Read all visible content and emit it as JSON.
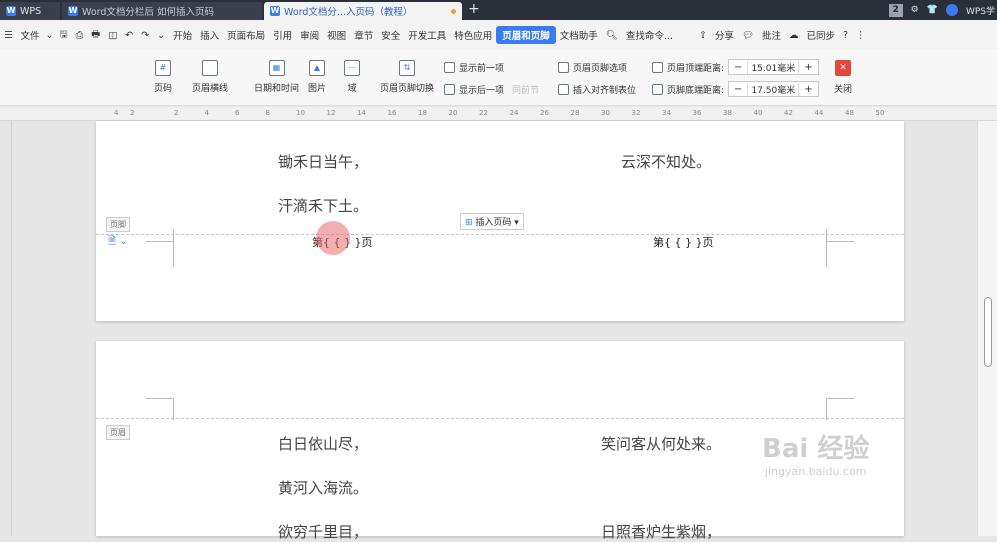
{
  "titlebar": {
    "wps": "WPS",
    "tab1": "Word文档分栏后 如何插入页码",
    "tab2": "Word文档分...入页码（教程）",
    "page_count": "2",
    "right_label": "WPS学"
  },
  "menu": {
    "items": [
      "文件",
      "开始",
      "插入",
      "页面布局",
      "引用",
      "审阅",
      "视图",
      "章节",
      "安全",
      "开发工具",
      "特色应用",
      "页眉和页脚",
      "文档助手"
    ],
    "search": "查找命令...",
    "share": "分享",
    "annotate": "批注",
    "sync": "已同步"
  },
  "ribbon": {
    "page_num": "页码",
    "header_line": "页眉横线",
    "datetime": "日期和时间",
    "picture": "图片",
    "field": "域",
    "switch": "页眉页脚切换",
    "show_prev": "显示前一项",
    "show_next": "显示后一项",
    "same_prev": "同前节",
    "hf_options": "页眉页脚选项",
    "insert_align": "插入对齐制表位",
    "header_top_label": "页眉顶端距离:",
    "header_top_value": "15.01毫米",
    "footer_bottom_label": "页脚底端距离:",
    "footer_bottom_value": "17.50毫米",
    "close": "关闭"
  },
  "ruler": {
    "ticks": [
      "4",
      "2",
      "2",
      "4",
      "6",
      "8",
      "10",
      "12",
      "14",
      "16",
      "18",
      "20",
      "22",
      "24",
      "26",
      "28",
      "30",
      "32",
      "34",
      "36",
      "38",
      "40",
      "42",
      "44",
      "48",
      "50"
    ]
  },
  "page1": {
    "left_lines": [
      "锄禾日当午，",
      "汗滴禾下土。"
    ],
    "right_lines": [
      "云深不知处。"
    ],
    "footer_label": "页脚",
    "insert_page_button": "插入页码",
    "footer_left_field": "第{ { } }页",
    "footer_right_field": "第{ { } }页"
  },
  "page2": {
    "header_label": "页眉",
    "left_lines": [
      "白日依山尽，",
      "黄河入海流。",
      "欲穷千里目，"
    ],
    "right_lines": [
      "笑问客从何处来。",
      "日照香炉生紫烟，"
    ]
  },
  "watermark": {
    "big": "Bai 经验",
    "small": "jingyan.baidu.com"
  },
  "colors": {
    "accent": "#3a7cf0",
    "titlebar": "#2b2f3a",
    "close": "#e2483d"
  }
}
